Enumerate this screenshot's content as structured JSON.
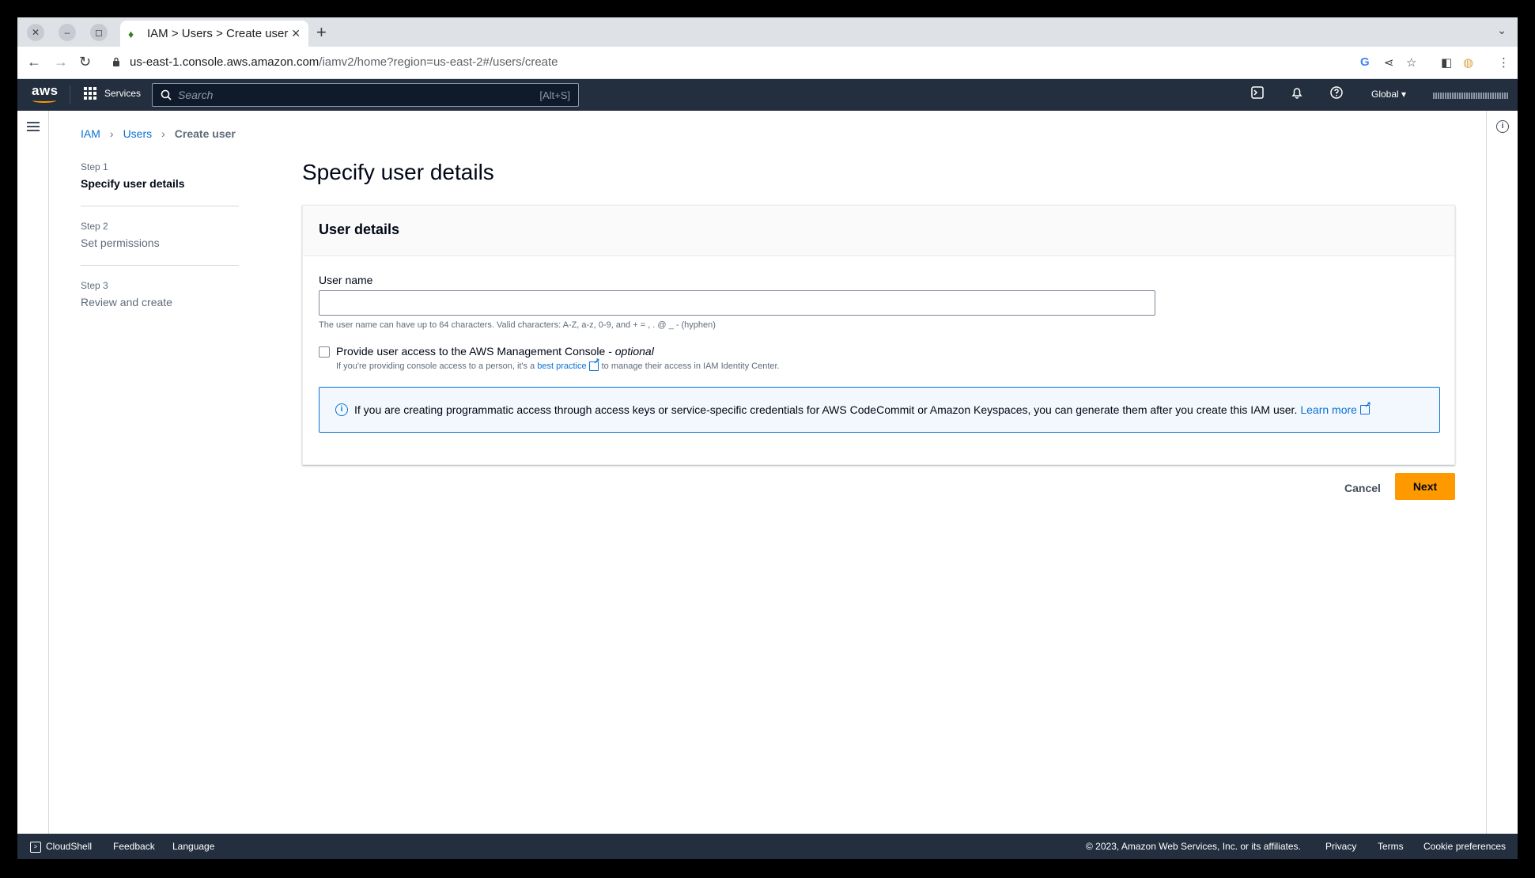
{
  "browser": {
    "tab_title": "IAM > Users > Create user",
    "url_domain": "us-east-1.console.aws.amazon.com",
    "url_path": "/iamv2/home?region=us-east-2#/users/create"
  },
  "aws_header": {
    "services_label": "Services",
    "search_placeholder": "Search",
    "search_shortcut": "[Alt+S]",
    "region_label": "Global ▾"
  },
  "breadcrumb": {
    "items": [
      "IAM",
      "Users",
      "Create user"
    ]
  },
  "steps": [
    {
      "num": "Step 1",
      "label": "Specify user details"
    },
    {
      "num": "Step 2",
      "label": "Set permissions"
    },
    {
      "num": "Step 3",
      "label": "Review and create"
    }
  ],
  "page": {
    "title": "Specify user details",
    "panel_title": "User details",
    "username_label": "User name",
    "username_value": "",
    "username_hint": "The user name can have up to 64 characters. Valid characters: A-Z, a-z, 0-9, and + = , . @ _ - (hyphen)",
    "console_access_label": "Provide user access to the AWS Management Console - ",
    "console_access_optional": "optional",
    "console_desc_prefix": "If you're providing console access to a person, it's a",
    "console_desc_link": "best practice",
    "console_desc_suffix": "to manage their access in IAM Identity Center.",
    "info_text": "If you are creating programmatic access through access keys or service-specific credentials for AWS CodeCommit or Amazon Keyspaces, you can generate them after you create this IAM user.",
    "info_link": "Learn more",
    "cancel_label": "Cancel",
    "next_label": "Next"
  },
  "footer": {
    "cloudshell": "CloudShell",
    "feedback": "Feedback",
    "language": "Language",
    "copyright": "© 2023, Amazon Web Services, Inc. or its affiliates.",
    "privacy": "Privacy",
    "terms": "Terms",
    "cookies": "Cookie preferences"
  },
  "colors": {
    "aws_header": "#232f3e",
    "link": "#0972d3",
    "primary_button": "#ff9900"
  }
}
